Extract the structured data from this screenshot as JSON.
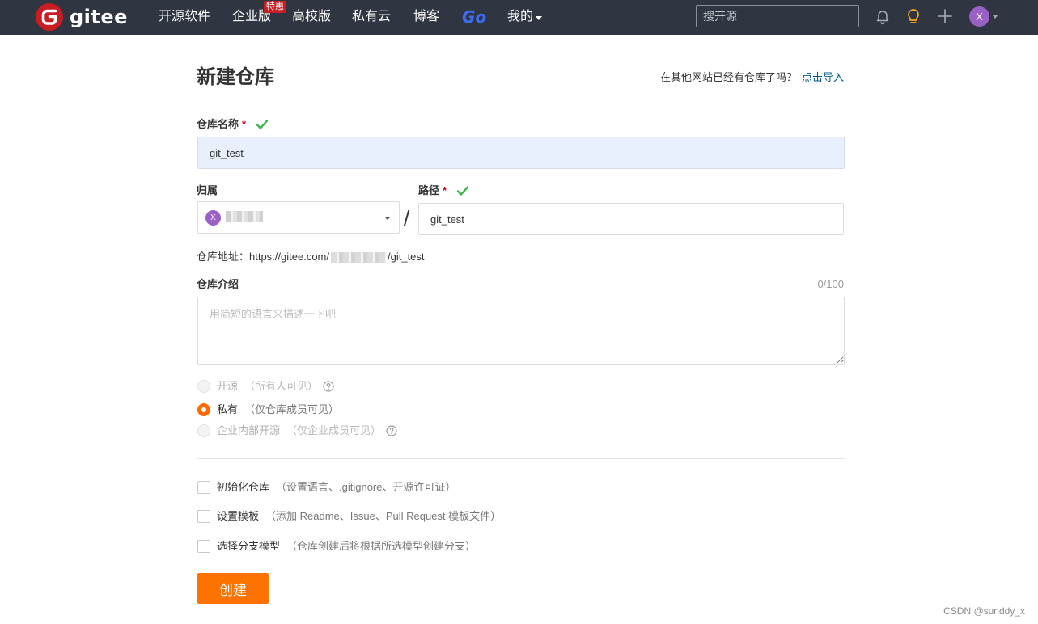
{
  "brand": {
    "name": "gitee",
    "color": "#c71d23"
  },
  "nav": {
    "items": [
      "开源软件",
      "企业版",
      "高校版",
      "私有云",
      "博客"
    ],
    "badge": "特惠",
    "go": "Go",
    "mine": "我的"
  },
  "search": {
    "placeholder": "搜开源"
  },
  "user": {
    "initial": "X"
  },
  "page": {
    "title": "新建仓库",
    "import_prompt": "在其他网站已经有仓库了吗？",
    "import_link": "点击导入"
  },
  "form": {
    "repo_name": {
      "label": "仓库名称",
      "required_mark": "*",
      "value": "git_test"
    },
    "owner": {
      "label": "归属",
      "avatar_initial": "X"
    },
    "separator": "/",
    "path": {
      "label": "路径",
      "required_mark": "*",
      "value": "git_test"
    },
    "repo_url": {
      "prefix": "仓库地址：https://gitee.com/",
      "suffix": "/git_test"
    },
    "description": {
      "label": "仓库介绍",
      "counter": "0/100",
      "placeholder": "用简短的语言来描述一下吧"
    },
    "visibility": [
      {
        "label": "开源",
        "hint": "（所有人可见）",
        "selected": false,
        "disabled": true,
        "help": true
      },
      {
        "label": "私有",
        "hint": "（仅仓库成员可见）",
        "selected": true,
        "disabled": false,
        "help": false
      },
      {
        "label": "企业内部开源",
        "hint": "（仅企业成员可见）",
        "selected": false,
        "disabled": true,
        "help": true
      }
    ],
    "options": [
      {
        "label": "初始化仓库",
        "hint": "（设置语言、.gitignore、开源许可证）",
        "checked": false
      },
      {
        "label": "设置模板",
        "hint": "（添加 Readme、Issue、Pull Request 模板文件）",
        "checked": false
      },
      {
        "label": "选择分支模型",
        "hint": "（仓库创建后将根据所选模型创建分支）",
        "checked": false
      }
    ],
    "submit_label": "创建"
  },
  "colors": {
    "accent": "#fe7300",
    "nav_bg": "#2f3541",
    "link": "#005980",
    "valid": "#3ab54a"
  },
  "watermark": "CSDN @sunddy_x"
}
